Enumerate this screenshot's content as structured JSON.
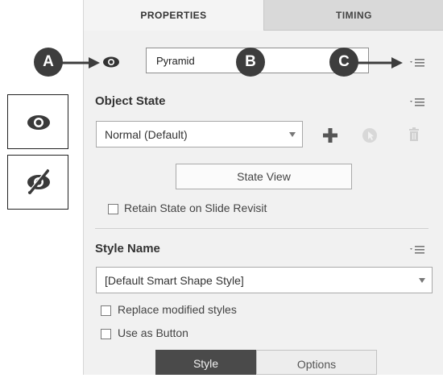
{
  "tabs": {
    "properties": "PROPERTIES",
    "timing": "TIMING"
  },
  "name_field": {
    "value": "Pyramid"
  },
  "callouts": {
    "a": "A",
    "b": "B",
    "c": "C"
  },
  "object_state": {
    "title": "Object State",
    "selected": "Normal (Default)",
    "state_view_button": "State View",
    "retain_label": "Retain State on Slide Revisit"
  },
  "style_name": {
    "title": "Style Name",
    "selected": "[Default Smart Shape Style]",
    "replace_label": "Replace modified styles",
    "use_as_button_label": "Use as Button"
  },
  "bottom_tabs": {
    "style": "Style",
    "options": "Options"
  },
  "icons": {
    "visibility": "eye-icon",
    "hidden": "eye-slash-icon",
    "panel_menu": "menu-icon",
    "add_state": "plus-icon",
    "disabled_action": "arrow-icon",
    "delete_state": "trash-icon"
  },
  "colors": {
    "badge": "#3d3d3d",
    "panel_bg": "#f1f1f1",
    "style_tab_active": "#4a4a4a",
    "plus": "#555555"
  }
}
